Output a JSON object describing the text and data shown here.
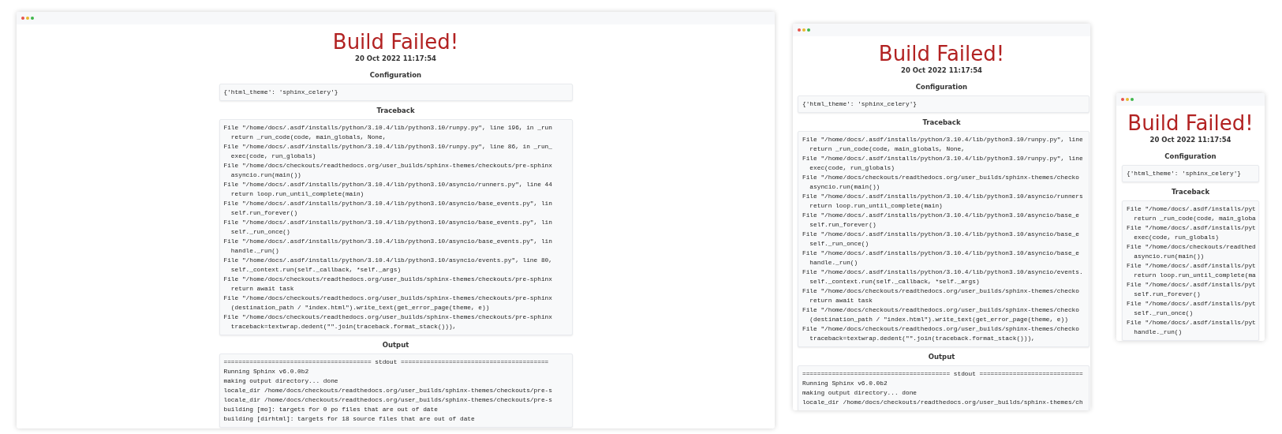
{
  "windows": [
    {
      "title": "Build Failed!",
      "date": "20 Oct 2022 11:17:54",
      "sections": [
        {
          "heading": "Configuration",
          "lines": [
            "{'html_theme': 'sphinx_celery'}"
          ]
        },
        {
          "heading": "Traceback",
          "lines": [
            "File \"/home/docs/.asdf/installs/python/3.10.4/lib/python3.10/runpy.py\", line 196, in _run",
            "  return _run_code(code, main_globals, None,",
            "File \"/home/docs/.asdf/installs/python/3.10.4/lib/python3.10/runpy.py\", line 86, in _run_",
            "  exec(code, run_globals)",
            "File \"/home/docs/checkouts/readthedocs.org/user_builds/sphinx-themes/checkouts/pre-sphinx",
            "  asyncio.run(main())",
            "File \"/home/docs/.asdf/installs/python/3.10.4/lib/python3.10/asyncio/runners.py\", line 44",
            "  return loop.run_until_complete(main)",
            "File \"/home/docs/.asdf/installs/python/3.10.4/lib/python3.10/asyncio/base_events.py\", lin",
            "  self.run_forever()",
            "File \"/home/docs/.asdf/installs/python/3.10.4/lib/python3.10/asyncio/base_events.py\", lin",
            "  self._run_once()",
            "File \"/home/docs/.asdf/installs/python/3.10.4/lib/python3.10/asyncio/base_events.py\", lin",
            "  handle._run()",
            "File \"/home/docs/.asdf/installs/python/3.10.4/lib/python3.10/asyncio/events.py\", line 80,",
            "  self._context.run(self._callback, *self._args)",
            "File \"/home/docs/checkouts/readthedocs.org/user_builds/sphinx-themes/checkouts/pre-sphinx",
            "  return await task",
            "File \"/home/docs/checkouts/readthedocs.org/user_builds/sphinx-themes/checkouts/pre-sphinx",
            "  (destination_path / \"index.html\").write_text(get_error_page(theme, e))",
            "File \"/home/docs/checkouts/readthedocs.org/user_builds/sphinx-themes/checkouts/pre-sphinx",
            "  traceback=textwrap.dedent(\"\".join(traceback.format_stack())),"
          ]
        },
        {
          "heading": "Output",
          "lines": [
            "======================================== stdout ========================================",
            "Running Sphinx v6.0.0b2",
            "making output directory... done",
            "locale_dir /home/docs/checkouts/readthedocs.org/user_builds/sphinx-themes/checkouts/pre-s",
            "locale_dir /home/docs/checkouts/readthedocs.org/user_builds/sphinx-themes/checkouts/pre-s",
            "building [mo]: targets for 0 po files that are out of date",
            "building [dirhtml]: targets for 18 source files that are out of date"
          ]
        }
      ]
    },
    {
      "title": "Build Failed!",
      "date": "20 Oct 2022 11:17:54",
      "sections": [
        {
          "heading": "Configuration",
          "lines": [
            "{'html_theme': 'sphinx_celery'}"
          ]
        },
        {
          "heading": "Traceback",
          "lines": [
            "File \"/home/docs/.asdf/installs/python/3.10.4/lib/python3.10/runpy.py\", line",
            "  return _run_code(code, main_globals, None,",
            "File \"/home/docs/.asdf/installs/python/3.10.4/lib/python3.10/runpy.py\", line",
            "  exec(code, run_globals)",
            "File \"/home/docs/checkouts/readthedocs.org/user_builds/sphinx-themes/checko",
            "  asyncio.run(main())",
            "File \"/home/docs/.asdf/installs/python/3.10.4/lib/python3.10/asyncio/runners",
            "  return loop.run_until_complete(main)",
            "File \"/home/docs/.asdf/installs/python/3.10.4/lib/python3.10/asyncio/base_e",
            "  self.run_forever()",
            "File \"/home/docs/.asdf/installs/python/3.10.4/lib/python3.10/asyncio/base_e",
            "  self._run_once()",
            "File \"/home/docs/.asdf/installs/python/3.10.4/lib/python3.10/asyncio/base_e",
            "  handle._run()",
            "File \"/home/docs/.asdf/installs/python/3.10.4/lib/python3.10/asyncio/events.",
            "  self._context.run(self._callback, *self._args)",
            "File \"/home/docs/checkouts/readthedocs.org/user_builds/sphinx-themes/checko",
            "  return await task",
            "File \"/home/docs/checkouts/readthedocs.org/user_builds/sphinx-themes/checko",
            "  (destination_path / \"index.html\").write_text(get_error_page(theme, e))",
            "File \"/home/docs/checkouts/readthedocs.org/user_builds/sphinx-themes/checko",
            "  traceback=textwrap.dedent(\"\".join(traceback.format_stack())),"
          ]
        },
        {
          "heading": "Output",
          "lines": [
            "======================================== stdout ============================",
            "Running Sphinx v6.0.0b2",
            "making output directory... done",
            "locale_dir /home/docs/checkouts/readthedocs.org/user_builds/sphinx-themes/ch"
          ]
        }
      ]
    },
    {
      "title": "Build Failed!",
      "date": "20 Oct 2022 11:17:54",
      "sections": [
        {
          "heading": "Configuration",
          "lines": [
            "{'html_theme': 'sphinx_celery'}"
          ]
        },
        {
          "heading": "Traceback",
          "lines": [
            "File \"/home/docs/.asdf/installs/pyt",
            "  return _run_code(code, main_globa",
            "File \"/home/docs/.asdf/installs/pyt",
            "  exec(code, run_globals)",
            "File \"/home/docs/checkouts/readthed",
            "  asyncio.run(main())",
            "File \"/home/docs/.asdf/installs/pyt",
            "  return loop.run_until_complete(ma",
            "File \"/home/docs/.asdf/installs/pyt",
            "  self.run_forever()",
            "File \"/home/docs/.asdf/installs/pyt",
            "  self._run_once()",
            "File \"/home/docs/.asdf/installs/pyt",
            "  handle._run()"
          ]
        }
      ]
    }
  ]
}
